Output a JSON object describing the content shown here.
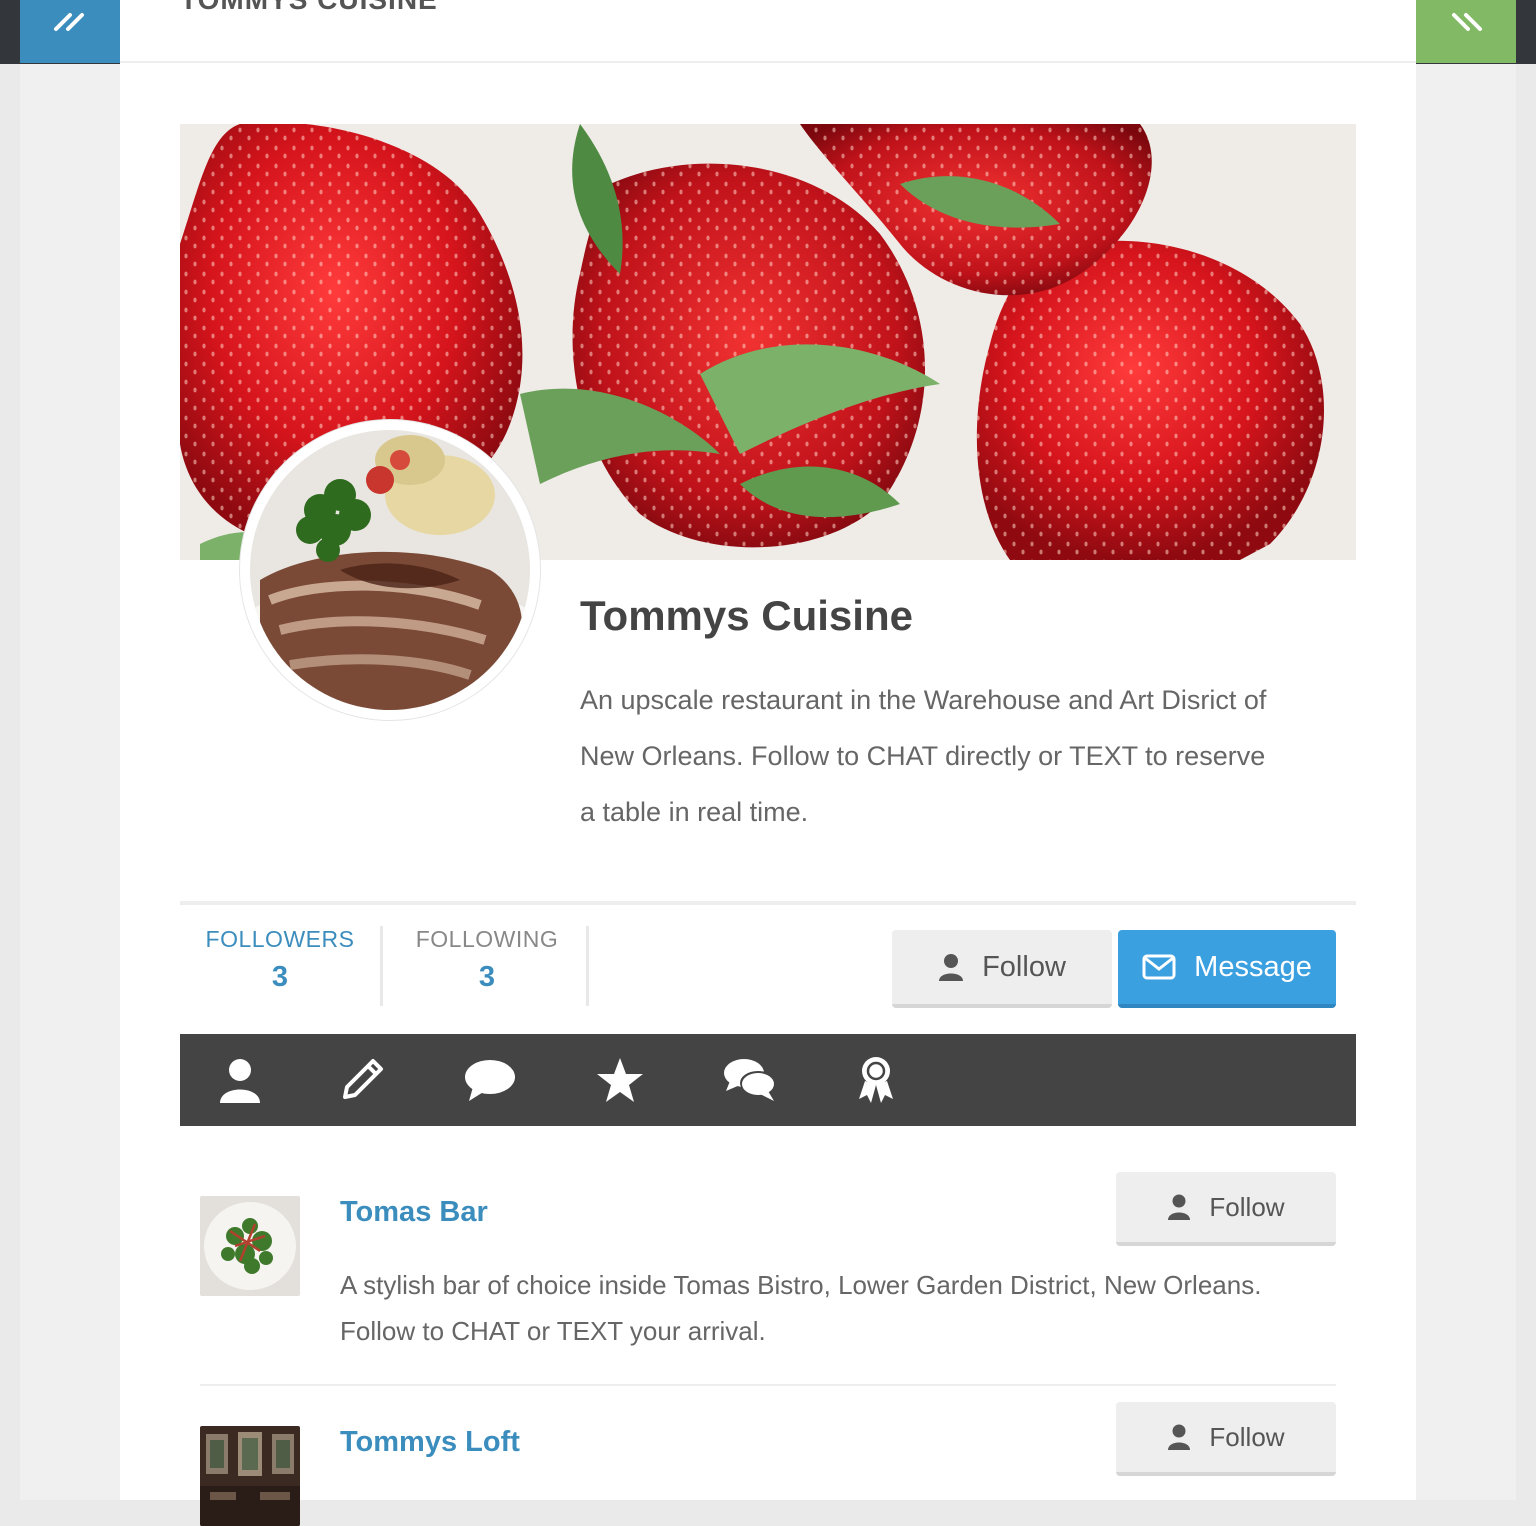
{
  "site": {
    "title": "TOMMYS CUISINE"
  },
  "profile": {
    "name": "Tommys Cuisine",
    "description": "An upscale restaurant in the Warehouse and Art Disrict of New Orleans. Follow to CHAT directly or TEXT to reserve a table in real time."
  },
  "stats": {
    "followers_label": "FOLLOWERS",
    "followers_count": "3",
    "following_label": "FOLLOWING",
    "following_count": "3"
  },
  "actions": {
    "follow_label": "Follow",
    "message_label": "Message"
  },
  "tabs": [
    {
      "icon": "user-icon"
    },
    {
      "icon": "pencil-icon"
    },
    {
      "icon": "comment-icon"
    },
    {
      "icon": "star-icon"
    },
    {
      "icon": "comments-icon"
    },
    {
      "icon": "award-icon"
    }
  ],
  "following_list": [
    {
      "name": "Tomas Bar",
      "description": "A stylish bar of choice inside Tomas Bistro, Lower Garden District, New Orleans. Follow to CHAT or TEXT your arrival.",
      "follow_label": "Follow"
    },
    {
      "name": "Tommys Loft",
      "description": "",
      "follow_label": "Follow"
    }
  ],
  "colors": {
    "accent_blue": "#3b8dbd",
    "message_blue": "#3ba0e0",
    "toggle_green": "#82b965",
    "tabbar": "#444444"
  }
}
